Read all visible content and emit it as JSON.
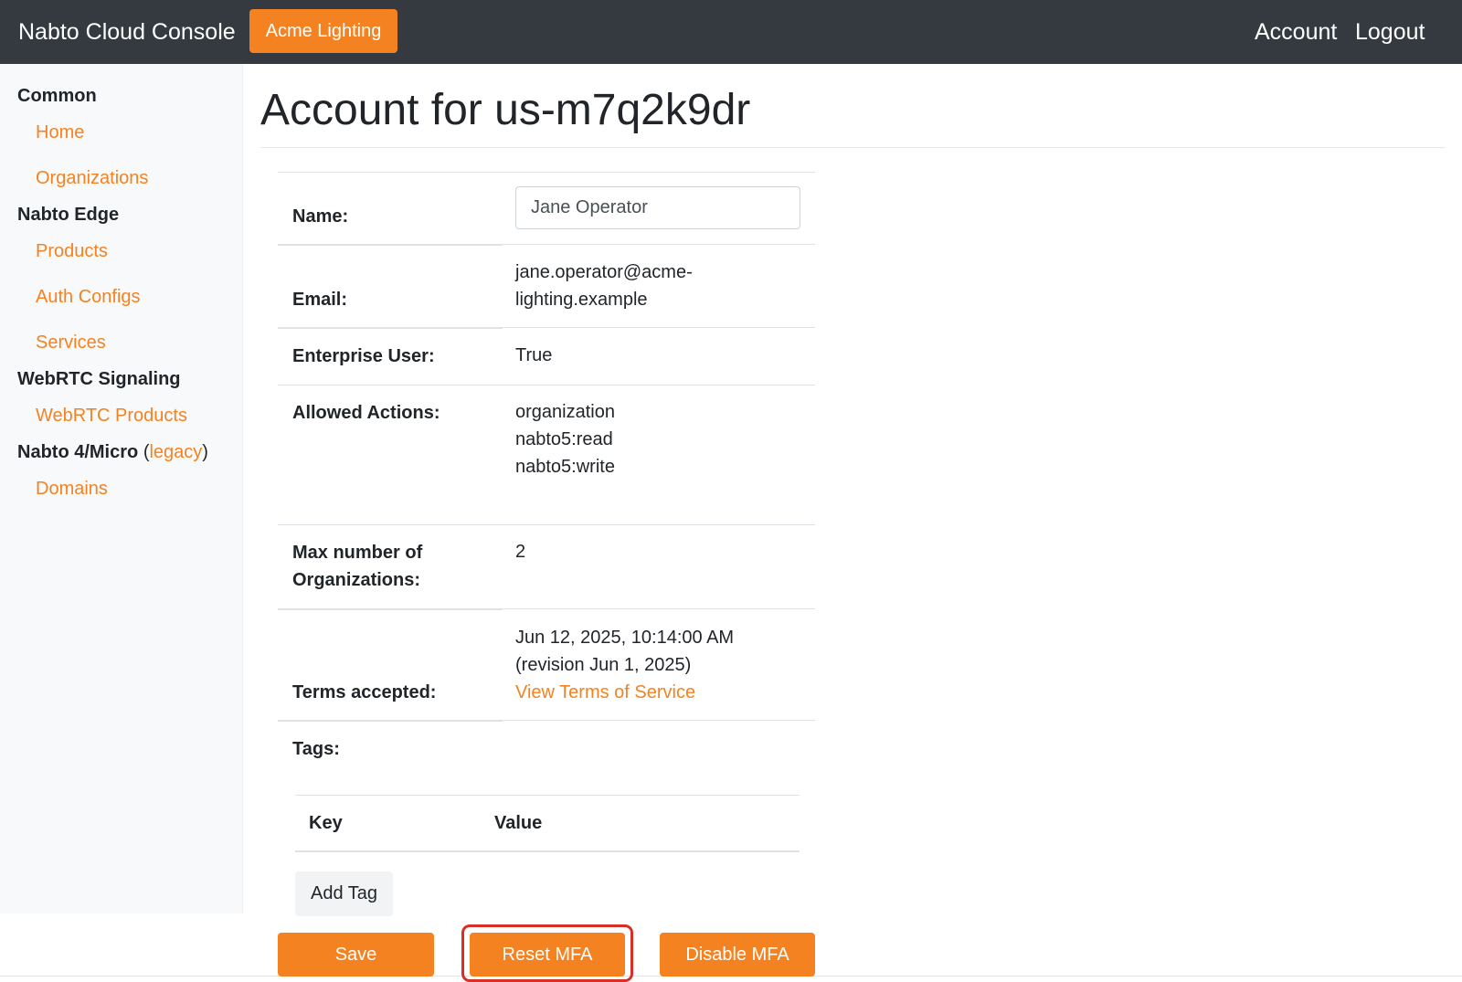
{
  "navbar": {
    "brand": "Nabto Cloud Console",
    "organization_button": "Acme Lighting",
    "account_link": "Account",
    "logout_link": "Logout"
  },
  "sidebar": {
    "common": {
      "heading": "Common",
      "items": [
        {
          "label": "Home"
        },
        {
          "label": "Organizations"
        }
      ]
    },
    "nabto_edge": {
      "heading": "Nabto Edge",
      "items": [
        {
          "label": "Products"
        },
        {
          "label": "Auth Configs"
        },
        {
          "label": "Services"
        }
      ]
    },
    "webrtc": {
      "heading": "WebRTC Signaling",
      "items": [
        {
          "label": "WebRTC Products"
        }
      ]
    },
    "nabto4": {
      "heading": "Nabto 4/Micro",
      "paren_open": "(",
      "legacy_link": "legacy",
      "paren_close": ")",
      "items": [
        {
          "label": "Domains"
        }
      ]
    }
  },
  "page": {
    "title": "Account for us-m7q2k9dr"
  },
  "account": {
    "name": {
      "label": "Name:",
      "value": "Jane Operator"
    },
    "email": {
      "label": "Email:",
      "line1": "jane.operator@acme-",
      "line2": "lighting.example"
    },
    "enterprise_user": {
      "label": "Enterprise User:",
      "value": "True"
    },
    "allowed_actions": {
      "label": "Allowed Actions:",
      "values": [
        "organization",
        "nabto5:read",
        "nabto5:write"
      ]
    },
    "max_orgs": {
      "label_line1": "Max number of",
      "label_line2": "Organizations:",
      "value": "2"
    },
    "terms": {
      "label": "Terms accepted:",
      "date": "Jun 12, 2025, 10:14:00 AM",
      "revision": "(revision Jun 1, 2025)",
      "view_link": "View Terms of Service"
    },
    "tags": {
      "label": "Tags:",
      "columns": [
        "Key",
        "Value"
      ],
      "add_button": "Add Tag"
    }
  },
  "actions": {
    "save": "Save",
    "reset_mfa": "Reset MFA",
    "disable_mfa": "Disable MFA",
    "highlight_color": "#d93025"
  },
  "colors": {
    "accent": "#f58220",
    "navbar": "#343a40",
    "sidebar": "#f8f9fa"
  }
}
